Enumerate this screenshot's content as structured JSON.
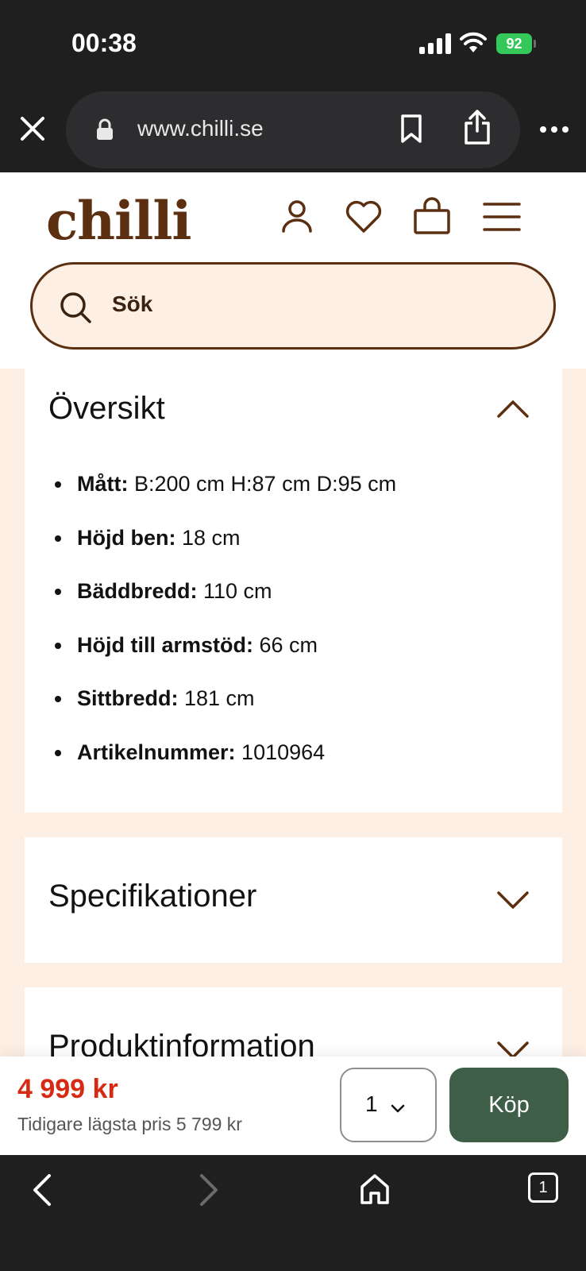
{
  "status_bar": {
    "time": "00:38",
    "battery": "92"
  },
  "browser": {
    "url": "www.chilli.se",
    "tab_count": "1"
  },
  "header": {
    "logo": "chilli",
    "search_placeholder": "Sök"
  },
  "overview": {
    "title": "Översikt",
    "expanded": true,
    "items": [
      {
        "label": "Mått:",
        "value": " B:200 cm H:87 cm D:95 cm"
      },
      {
        "label": "Höjd ben:",
        "value": " 18 cm"
      },
      {
        "label": "Bäddbredd:",
        "value": " 110 cm"
      },
      {
        "label": "Höjd till armstöd:",
        "value": " 66 cm"
      },
      {
        "label": "Sittbredd:",
        "value": " 181 cm"
      },
      {
        "label": "Artikelnummer:",
        "value": " 1010964"
      }
    ]
  },
  "specifications": {
    "title": "Specifikationer",
    "expanded": false
  },
  "product_info": {
    "title": "Produktinformation",
    "expanded": false
  },
  "buy_bar": {
    "price": "4 999 kr",
    "previous_price": "Tidigare lägsta pris 5 799 kr",
    "quantity": "1",
    "buy_label": "Köp"
  },
  "colors": {
    "brand_brown": "#5b2f10",
    "background_cream": "#fdefe4",
    "price_red": "#d62b12",
    "buy_green": "#3e5e47"
  }
}
